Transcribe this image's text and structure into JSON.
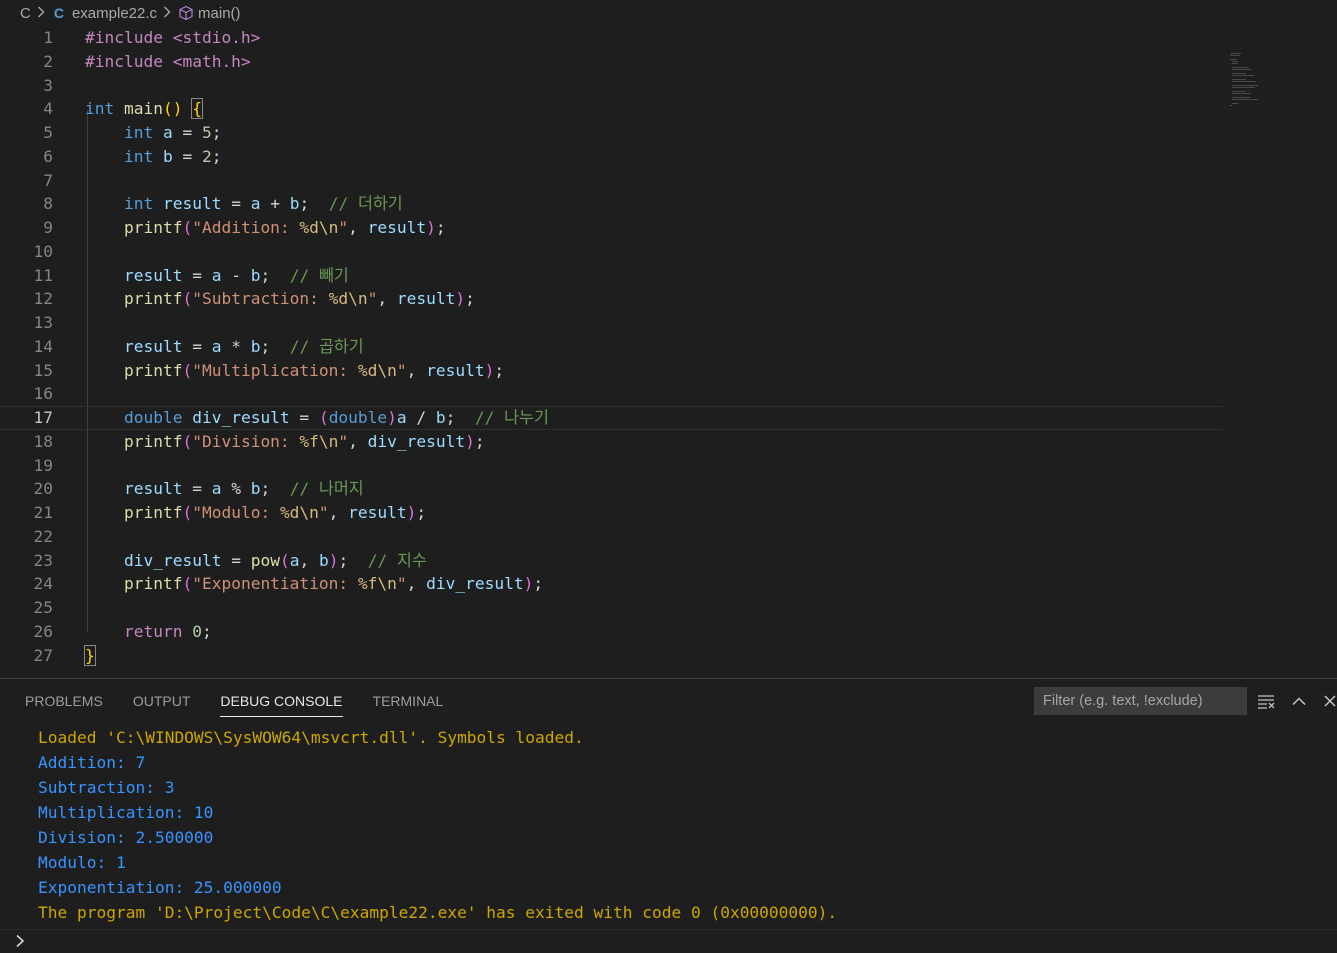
{
  "breadcrumb": {
    "root": "C",
    "file_icon": "C",
    "file": "example22.c",
    "symbol": "main()"
  },
  "editor": {
    "current_line": 17,
    "lines": [
      [
        {
          "t": "#include <stdio.h>",
          "c": "pp"
        }
      ],
      [
        {
          "t": "#include <math.h>",
          "c": "pp"
        }
      ],
      [],
      [
        {
          "t": "int",
          "c": "kw"
        },
        {
          "t": " "
        },
        {
          "t": "main",
          "c": "fn"
        },
        {
          "t": "() ",
          "c": "br1"
        },
        {
          "t": "{",
          "c": "brm"
        }
      ],
      [
        {
          "t": "    "
        },
        {
          "t": "int",
          "c": "kw"
        },
        {
          "t": " "
        },
        {
          "t": "a",
          "c": "var"
        },
        {
          "t": " = "
        },
        {
          "t": "5",
          "c": "num"
        },
        {
          "t": ";"
        }
      ],
      [
        {
          "t": "    "
        },
        {
          "t": "int",
          "c": "kw"
        },
        {
          "t": " "
        },
        {
          "t": "b",
          "c": "var"
        },
        {
          "t": " = "
        },
        {
          "t": "2",
          "c": "num"
        },
        {
          "t": ";"
        }
      ],
      [],
      [
        {
          "t": "    "
        },
        {
          "t": "int",
          "c": "kw"
        },
        {
          "t": " "
        },
        {
          "t": "result",
          "c": "var"
        },
        {
          "t": " = "
        },
        {
          "t": "a",
          "c": "var"
        },
        {
          "t": " + "
        },
        {
          "t": "b",
          "c": "var"
        },
        {
          "t": ";  "
        },
        {
          "t": "// 더하기",
          "c": "cmt"
        }
      ],
      [
        {
          "t": "    "
        },
        {
          "t": "printf",
          "c": "fn"
        },
        {
          "t": "(",
          "c": "br2"
        },
        {
          "t": "\"Addition: ",
          "c": "str"
        },
        {
          "t": "%d\\n",
          "c": "esc"
        },
        {
          "t": "\"",
          "c": "str"
        },
        {
          "t": ", "
        },
        {
          "t": "result",
          "c": "var"
        },
        {
          "t": ")",
          "c": "br2"
        },
        {
          "t": ";"
        }
      ],
      [],
      [
        {
          "t": "    "
        },
        {
          "t": "result",
          "c": "var"
        },
        {
          "t": " = "
        },
        {
          "t": "a",
          "c": "var"
        },
        {
          "t": " - "
        },
        {
          "t": "b",
          "c": "var"
        },
        {
          "t": ";  "
        },
        {
          "t": "// 빼기",
          "c": "cmt"
        }
      ],
      [
        {
          "t": "    "
        },
        {
          "t": "printf",
          "c": "fn"
        },
        {
          "t": "(",
          "c": "br2"
        },
        {
          "t": "\"Subtraction: ",
          "c": "str"
        },
        {
          "t": "%d\\n",
          "c": "esc"
        },
        {
          "t": "\"",
          "c": "str"
        },
        {
          "t": ", "
        },
        {
          "t": "result",
          "c": "var"
        },
        {
          "t": ")",
          "c": "br2"
        },
        {
          "t": ";"
        }
      ],
      [],
      [
        {
          "t": "    "
        },
        {
          "t": "result",
          "c": "var"
        },
        {
          "t": " = "
        },
        {
          "t": "a",
          "c": "var"
        },
        {
          "t": " * "
        },
        {
          "t": "b",
          "c": "var"
        },
        {
          "t": ";  "
        },
        {
          "t": "// 곱하기",
          "c": "cmt"
        }
      ],
      [
        {
          "t": "    "
        },
        {
          "t": "printf",
          "c": "fn"
        },
        {
          "t": "(",
          "c": "br2"
        },
        {
          "t": "\"Multiplication: ",
          "c": "str"
        },
        {
          "t": "%d\\n",
          "c": "esc"
        },
        {
          "t": "\"",
          "c": "str"
        },
        {
          "t": ", "
        },
        {
          "t": "result",
          "c": "var"
        },
        {
          "t": ")",
          "c": "br2"
        },
        {
          "t": ";"
        }
      ],
      [],
      [
        {
          "t": "    "
        },
        {
          "t": "double",
          "c": "kw"
        },
        {
          "t": " "
        },
        {
          "t": "div_result",
          "c": "var"
        },
        {
          "t": " = "
        },
        {
          "t": "(",
          "c": "br2"
        },
        {
          "t": "double",
          "c": "kw"
        },
        {
          "t": ")",
          "c": "br2"
        },
        {
          "t": "a",
          "c": "var"
        },
        {
          "t": " / "
        },
        {
          "t": "b",
          "c": "var"
        },
        {
          "t": ";  "
        },
        {
          "t": "// 나누기",
          "c": "cmt"
        }
      ],
      [
        {
          "t": "    "
        },
        {
          "t": "printf",
          "c": "fn"
        },
        {
          "t": "(",
          "c": "br2"
        },
        {
          "t": "\"Division: ",
          "c": "str"
        },
        {
          "t": "%f\\n",
          "c": "esc"
        },
        {
          "t": "\"",
          "c": "str"
        },
        {
          "t": ", "
        },
        {
          "t": "div_result",
          "c": "var"
        },
        {
          "t": ")",
          "c": "br2"
        },
        {
          "t": ";"
        }
      ],
      [],
      [
        {
          "t": "    "
        },
        {
          "t": "result",
          "c": "var"
        },
        {
          "t": " = "
        },
        {
          "t": "a",
          "c": "var"
        },
        {
          "t": " % "
        },
        {
          "t": "b",
          "c": "var"
        },
        {
          "t": ";  "
        },
        {
          "t": "// 나머지",
          "c": "cmt"
        }
      ],
      [
        {
          "t": "    "
        },
        {
          "t": "printf",
          "c": "fn"
        },
        {
          "t": "(",
          "c": "br2"
        },
        {
          "t": "\"Modulo: ",
          "c": "str"
        },
        {
          "t": "%d\\n",
          "c": "esc"
        },
        {
          "t": "\"",
          "c": "str"
        },
        {
          "t": ", "
        },
        {
          "t": "result",
          "c": "var"
        },
        {
          "t": ")",
          "c": "br2"
        },
        {
          "t": ";"
        }
      ],
      [],
      [
        {
          "t": "    "
        },
        {
          "t": "div_result",
          "c": "var"
        },
        {
          "t": " = "
        },
        {
          "t": "pow",
          "c": "fn"
        },
        {
          "t": "(",
          "c": "br2"
        },
        {
          "t": "a",
          "c": "var"
        },
        {
          "t": ", "
        },
        {
          "t": "b",
          "c": "var"
        },
        {
          "t": ")",
          "c": "br2"
        },
        {
          "t": ";  "
        },
        {
          "t": "// 지수",
          "c": "cmt"
        }
      ],
      [
        {
          "t": "    "
        },
        {
          "t": "printf",
          "c": "fn"
        },
        {
          "t": "(",
          "c": "br2"
        },
        {
          "t": "\"Exponentiation: ",
          "c": "str"
        },
        {
          "t": "%f\\n",
          "c": "esc"
        },
        {
          "t": "\"",
          "c": "str"
        },
        {
          "t": ", "
        },
        {
          "t": "div_result",
          "c": "var"
        },
        {
          "t": ")",
          "c": "br2"
        },
        {
          "t": ";"
        }
      ],
      [],
      [
        {
          "t": "    "
        },
        {
          "t": "return",
          "c": "ctrl"
        },
        {
          "t": " "
        },
        {
          "t": "0",
          "c": "num"
        },
        {
          "t": ";"
        }
      ],
      [
        {
          "t": "}",
          "c": "brm"
        }
      ]
    ]
  },
  "panel": {
    "tabs": [
      "PROBLEMS",
      "OUTPUT",
      "DEBUG CONSOLE",
      "TERMINAL"
    ],
    "active_tab": "DEBUG CONSOLE",
    "filter_placeholder": "Filter (e.g. text, !exclude)",
    "console": [
      {
        "text": "Loaded 'C:\\WINDOWS\\SysWOW64\\msvcrt.dll'. Symbols loaded.",
        "kind": "warn"
      },
      {
        "text": "Addition: 7",
        "kind": "out"
      },
      {
        "text": "Subtraction: 3",
        "kind": "out"
      },
      {
        "text": "Multiplication: 10",
        "kind": "out"
      },
      {
        "text": "Division: 2.500000",
        "kind": "out"
      },
      {
        "text": "Modulo: 1",
        "kind": "out"
      },
      {
        "text": "Exponentiation: 25.000000",
        "kind": "out"
      },
      {
        "text": "The program 'D:\\Project\\Code\\C\\example22.exe' has exited with code 0 (0x00000000).",
        "kind": "warn"
      }
    ],
    "icons": [
      "filter-menu-icon",
      "chevron-up-icon",
      "close-icon"
    ]
  },
  "colors": {
    "background": "#1e1e1e",
    "keyword": "#569cd6",
    "function": "#dcdcaa",
    "variable": "#9cdcfe",
    "string": "#ce9178",
    "comment": "#6a9955",
    "console_output": "#3794ff",
    "console_warning": "#cca700"
  }
}
